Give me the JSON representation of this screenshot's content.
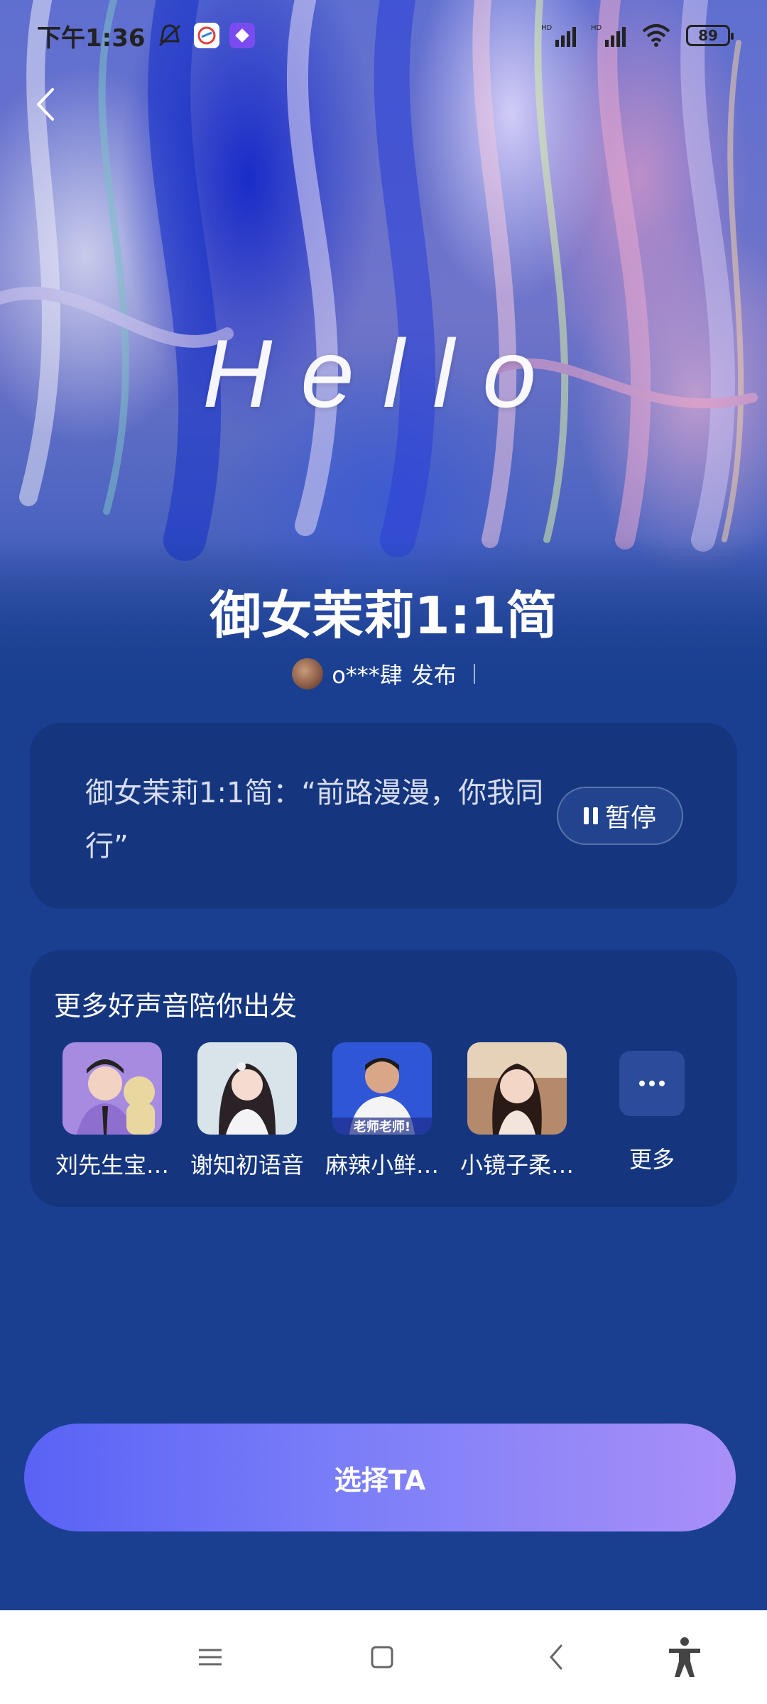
{
  "status_bar": {
    "time": "下午1:36",
    "battery": "89",
    "signal_label_1": "HD",
    "signal_label_2": "HD"
  },
  "hero": {
    "hello_text": "Hello",
    "title": "御女茉莉1:1简",
    "publisher_name": "o***肆",
    "publisher_action": "发布"
  },
  "quote_card": {
    "text": "御女茉莉1:1简：“前路漫漫，你我同行”",
    "pause_label": "暂停"
  },
  "more_voices": {
    "title": "更多好声音陪你出发",
    "items": [
      {
        "name": "刘先生宝…"
      },
      {
        "name": "谢知初语音"
      },
      {
        "name": "麻辣小鲜…"
      },
      {
        "name": "小镜子柔…"
      }
    ],
    "more_label": "更多",
    "avatar_overlay_text": "老师老师!"
  },
  "select_button": {
    "label": "选择TA"
  },
  "colors": {
    "background": "#1a3f91",
    "card": "#15367f",
    "button_start": "#5a62f6",
    "button_end": "#a98ff8"
  }
}
